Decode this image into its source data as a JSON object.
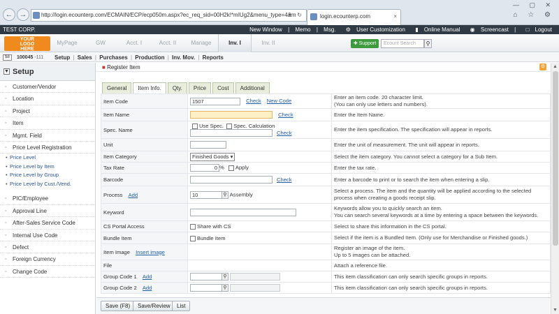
{
  "browser": {
    "url": "http://login.ecounterp.com/ECMAIN/ECP/ecp050m.aspx?ec_req_sid=00H2k!*mIUg2&menu_type=4&m",
    "url_controls": "▾ ↻",
    "tab_title": "login.ecounterp.com",
    "tab_close": "×",
    "window_controls": "— ▢ ✕",
    "icons": "⌂ ☆ ⚙"
  },
  "topbar": {
    "company": "TEST CORP.",
    "links": [
      "New Window",
      "|",
      "Memo",
      "|",
      "Msg.",
      "User Customization",
      "Online Manual",
      "Screencast",
      "|",
      "Logout"
    ]
  },
  "logo": {
    "line1": "YOUR",
    "line2": "LOGO",
    "line3": "HERE"
  },
  "modules": [
    "MyPage",
    "GW",
    "Acct. I",
    "Acct. II",
    "Manage",
    "Inv. I",
    "Inv. II"
  ],
  "active_module": "Inv. I",
  "support_label": "Support",
  "search_placeholder": "Ecount Search",
  "subnav": {
    "badge": "$8",
    "code": "100045",
    "code_suffix": "-111",
    "items": [
      "Setup",
      "|",
      "Sales",
      "|",
      "Purchases",
      "|",
      "Production",
      "|",
      "Inv. Mov.",
      "|",
      "Reports"
    ]
  },
  "sidebar": {
    "title": "Setup",
    "toggle": "▼",
    "items_top": [
      "Customer/Vendor",
      "Location",
      "Project",
      "Item",
      "Mgmt. Field",
      "Price Level Registration"
    ],
    "sub_items": [
      "Price Level",
      "Price Level by Item",
      "Price Level by Group",
      "Price Level by Cust./Vend."
    ],
    "items_bottom": [
      "PIC/Employee",
      "Approval Line",
      "After-Sales Service Code",
      "Internal Use Code",
      "Defect",
      "Foreign Currency",
      "Change Code"
    ]
  },
  "main": {
    "title": "Register Item",
    "tabs": [
      "General",
      "Item Info.",
      "Qty.",
      "Price",
      "Cost",
      "Additional"
    ],
    "active_tab": "Item Info.",
    "rows": {
      "item_code": {
        "label": "Item Code",
        "value": "1507",
        "check": "Check",
        "new_code": "New Code",
        "desc1": "Enter an item code. 20 character limit.",
        "desc2": "(You can only use letters and numbers)."
      },
      "item_name": {
        "label": "Item Name",
        "check": "Check",
        "desc": "Enter the Item Name."
      },
      "spec_name": {
        "label": "Spec. Name",
        "use_spec": "Use Spec.",
        "spec_calc": "Spec. Calculation",
        "check": "Check",
        "desc": "Enter the item specification. The specification will appear in reports."
      },
      "unit": {
        "label": "Unit",
        "desc": "Enter the unit of measurement. The unit will appear in reports."
      },
      "item_category": {
        "label": "Item Category",
        "value": "Finished Goods",
        "desc": "Select the item category. You cannot select a category for a Sub Item."
      },
      "tax_rate": {
        "label": "Tax Rate",
        "value": "0",
        "unit": "%",
        "apply": "Apply",
        "desc": "Enter the tax rate."
      },
      "barcode": {
        "label": "Barcode",
        "check": "Check",
        "desc": "Enter a barcode to print or to search the item when entering a slip."
      },
      "process": {
        "label": "Process",
        "add": "Add",
        "value": "10",
        "name": "Assembly",
        "desc1": "Select a process. The item and the quantity will be applied according to the selected",
        "desc2": "process when creating a goods receipt slip."
      },
      "keyword": {
        "label": "Keyword",
        "desc1": "Keywords allow you to quickly search an item.",
        "desc2": "You can search several keywords at a time by entering a space between the keywords."
      },
      "cs_portal": {
        "label": "CS Portal Access",
        "option": "Share with CS",
        "desc": "Select to share this information in the CS portal."
      },
      "bundle": {
        "label": "Bundle Item",
        "option": "Bundle Item",
        "desc": "Select if the item is a Bundled Item. (Only use for Merchandise or Finished goods.)"
      },
      "image": {
        "label": "Item Image",
        "link": "Insert image",
        "desc1": "Register an image of the item.",
        "desc2": "Up to 5 images can be attached."
      },
      "file": {
        "label": "File",
        "desc": "Attach a reference file."
      },
      "group1": {
        "label": "Group Code 1",
        "add": "Add",
        "desc": "This item classification can only search specific groups in reports."
      },
      "group2": {
        "label": "Group Code 2",
        "add": "Add",
        "desc": "This item classification can only search specific groups in reports."
      }
    },
    "buttons": {
      "save": "Save (F8)",
      "save_review": "Save/Review",
      "list": "List"
    }
  },
  "colors": {
    "brand": "#f08a1c",
    "support": "#3e9a3e",
    "topbar": "#2f3a45",
    "tab_bg": "#e8eedb"
  }
}
